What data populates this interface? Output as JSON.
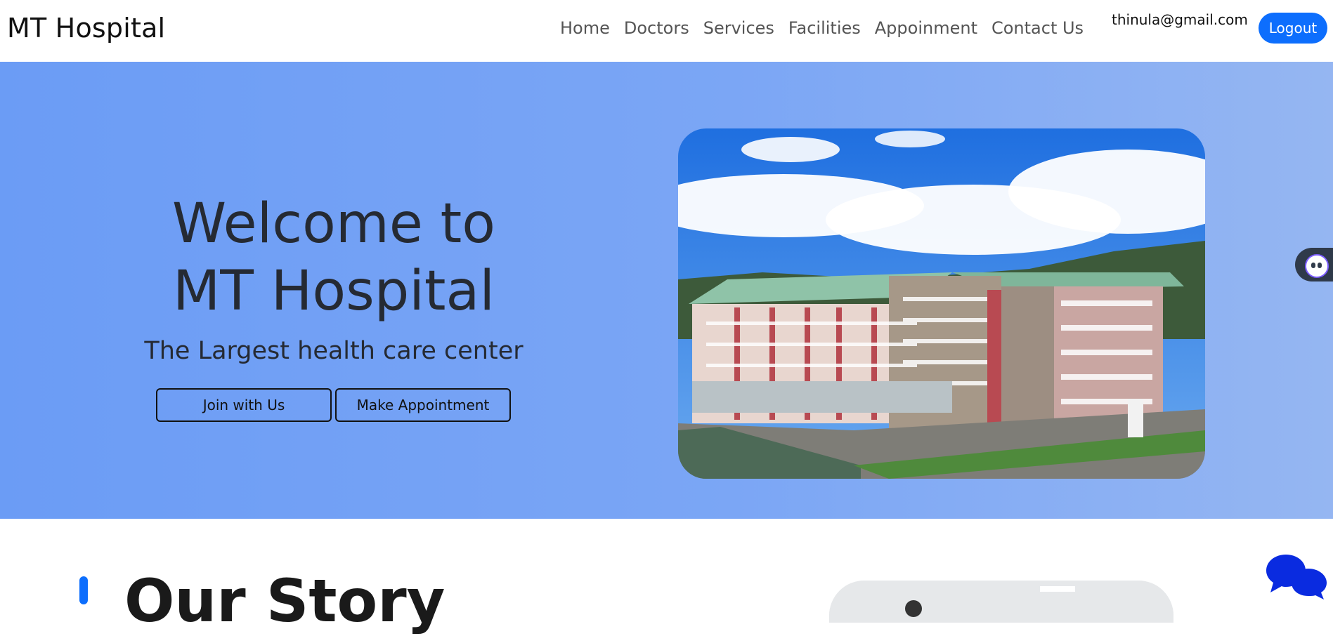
{
  "header": {
    "brand": "MT Hospital",
    "nav": [
      "Home",
      "Doctors",
      "Services",
      "Facilities",
      "Appoinment",
      "Contact Us"
    ],
    "user_email": "thinula@gmail.com",
    "logout_label": "Logout"
  },
  "hero": {
    "title_line1": "Welcome to",
    "title_line2": "MT Hospital",
    "subtitle": "The Largest health care center",
    "join_label": "Join with Us",
    "appointment_label": "Make Appointment"
  },
  "story": {
    "title": "Our Story"
  },
  "icons": {
    "assistant": "assistant-bot-icon",
    "chat": "chat-bubbles-icon"
  },
  "colors": {
    "accent": "#0d6efd",
    "hero_background": "#7ba6f5",
    "chat_icon": "#0a2be0"
  }
}
